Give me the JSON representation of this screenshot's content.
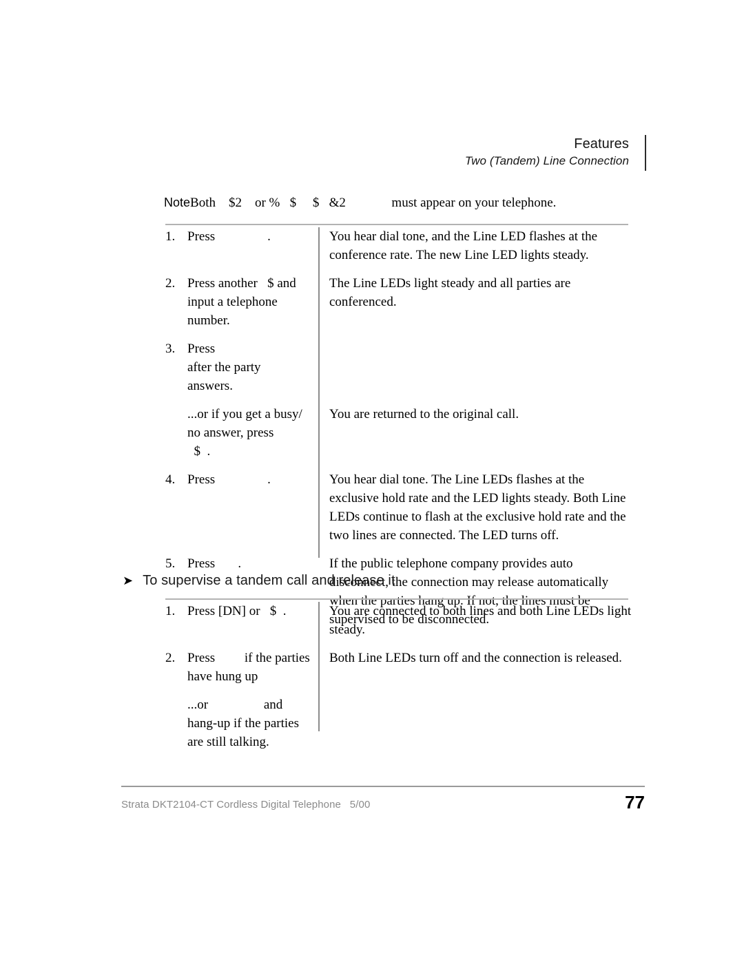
{
  "header": {
    "title": "Features",
    "subtitle": "Two (Tandem) Line Connection"
  },
  "note": {
    "label": "Note",
    "text": "Both    $2    or %   $     $   &2              must appear on your telephone."
  },
  "procedure_one": {
    "steps": [
      {
        "number": "1.",
        "action": "Press                .",
        "result": "You hear dial tone, and the Line LED flashes at the conference rate. The new Line LED lights steady."
      },
      {
        "number": "2.",
        "action": "Press another   $ and input a telephone number.",
        "result": "The Line LEDs light steady and all parties are conferenced."
      },
      {
        "number": "3.",
        "action": "Press\nafter the party\nanswers.",
        "result": ""
      }
    ],
    "substep": {
      "action": "...or if you get a busy/ no answer, press\n  $  .",
      "result": "You are returned to the original call."
    },
    "steps_continued": [
      {
        "number": "4.",
        "action": "Press                .",
        "result": "You hear dial tone. The Line LEDs flashes at the exclusive hold rate and the LED lights steady. Both Line LEDs continue to flash at the exclusive hold rate and the two lines are connected. The LED turns off."
      },
      {
        "number": "5.",
        "action": "Press       .",
        "result": "If the public telephone company provides auto disconnect, the connection may release automatically when the parties hang up. If not, the lines must be supervised to be disconnected."
      }
    ]
  },
  "section_heading": {
    "arrow": "➤",
    "text": "To supervise a tandem call and release it"
  },
  "procedure_two": {
    "steps": [
      {
        "number": "1.",
        "action": "Press [DN] or   $  .",
        "result": "You are connected to both lines and both Line LEDs light steady."
      },
      {
        "number": "2.",
        "action": "Press         if the parties have hung up",
        "result": "Both Line LEDs turn off and the connection is released."
      }
    ],
    "substep": {
      "action": "...or                 and hang-up if the parties are still talking.",
      "result": ""
    }
  },
  "footer": {
    "document": "Strata DKT2104-CT Cordless Digital Telephone   5/00",
    "page_number": "77"
  }
}
